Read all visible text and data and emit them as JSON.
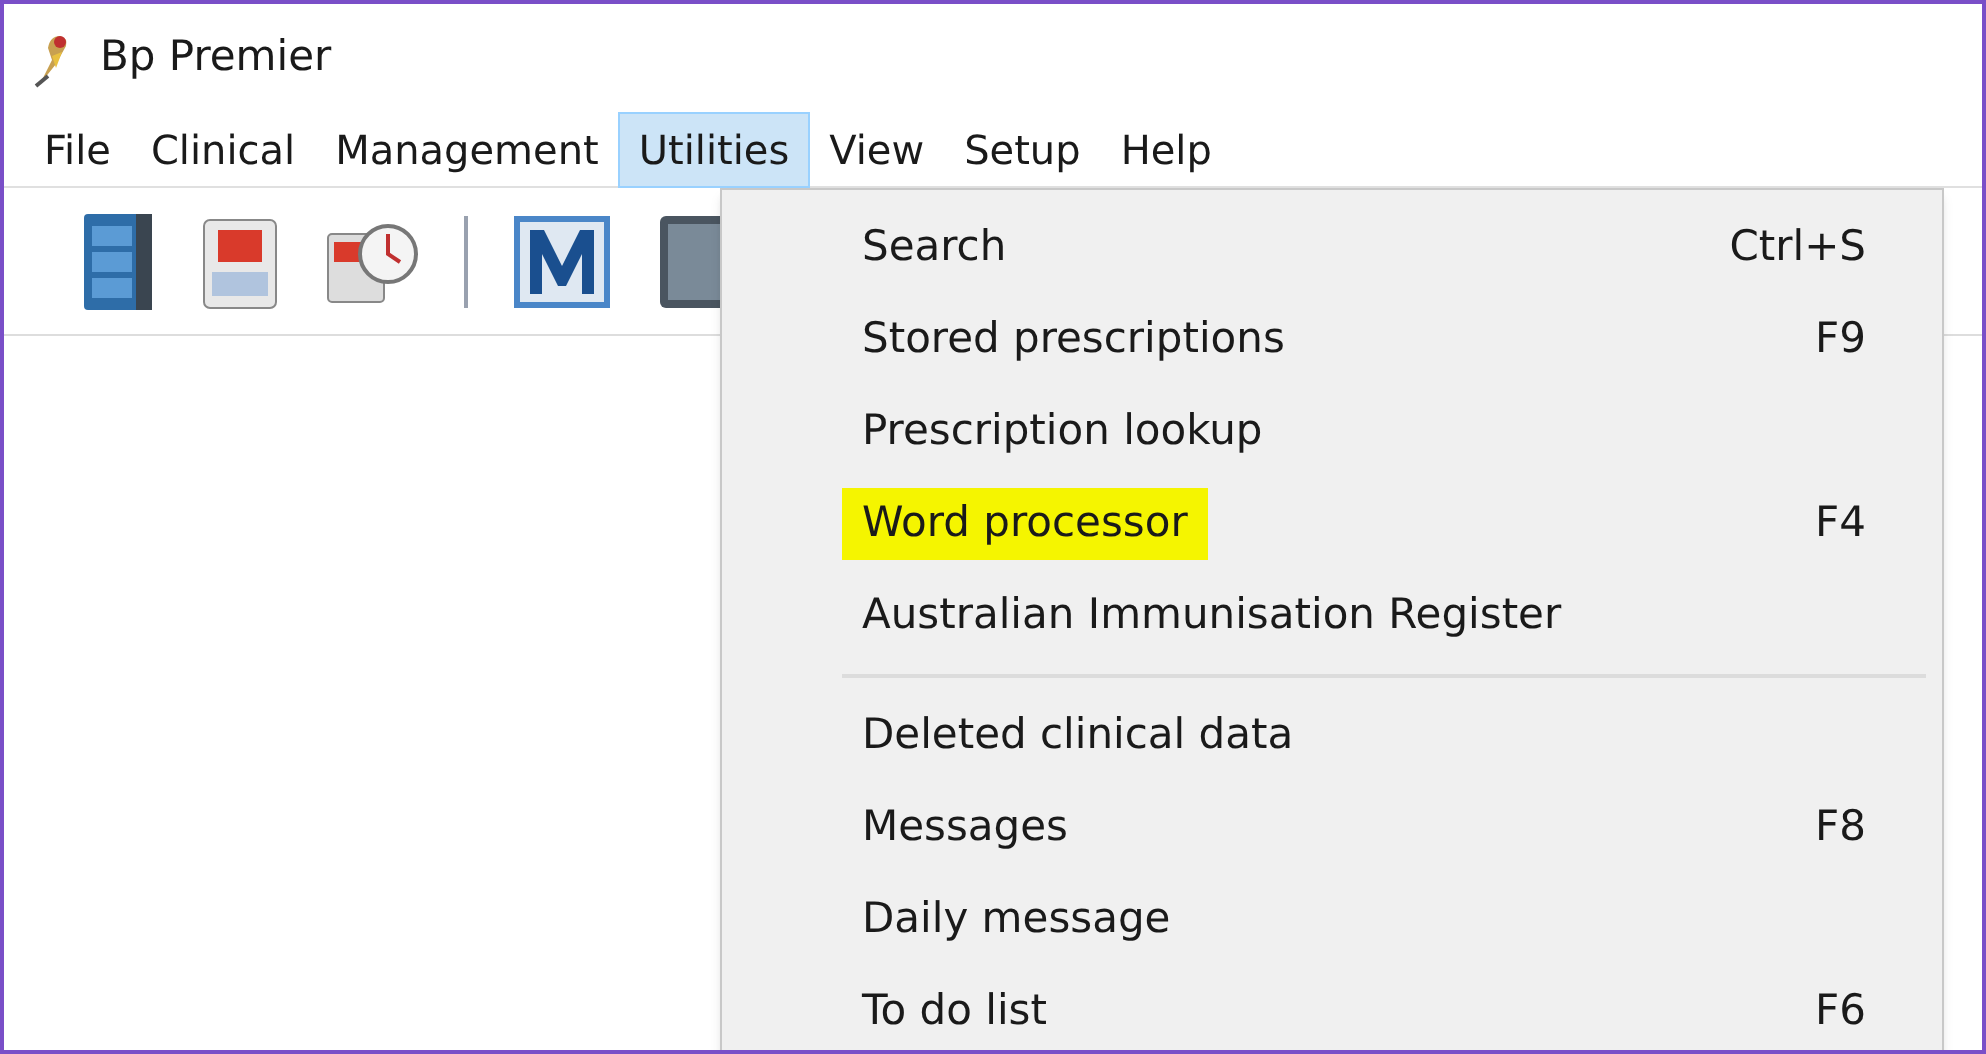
{
  "window": {
    "title": "Bp Premier"
  },
  "menu_bar": [
    {
      "label": "File",
      "selected": false
    },
    {
      "label": "Clinical",
      "selected": false
    },
    {
      "label": "Management",
      "selected": false
    },
    {
      "label": "Utilities",
      "selected": true
    },
    {
      "label": "View",
      "selected": false
    },
    {
      "label": "Setup",
      "selected": false
    },
    {
      "label": "Help",
      "selected": false
    }
  ],
  "dropdown": {
    "groups": [
      [
        {
          "label": "Search",
          "shortcut": "Ctrl+S",
          "highlighted": false
        },
        {
          "label": "Stored prescriptions",
          "shortcut": "F9",
          "highlighted": false
        },
        {
          "label": "Prescription lookup",
          "highlighted": false
        },
        {
          "label": "Word processor",
          "shortcut": "F4",
          "highlighted": true
        },
        {
          "label": "Australian Immunisation Register",
          "highlighted": false
        }
      ],
      [
        {
          "label": "Deleted clinical data",
          "highlighted": false
        },
        {
          "label": "Messages",
          "shortcut": "F8",
          "highlighted": false
        },
        {
          "label": "Daily message",
          "highlighted": false
        },
        {
          "label": "To do list",
          "shortcut": "F6",
          "highlighted": false
        }
      ]
    ]
  }
}
